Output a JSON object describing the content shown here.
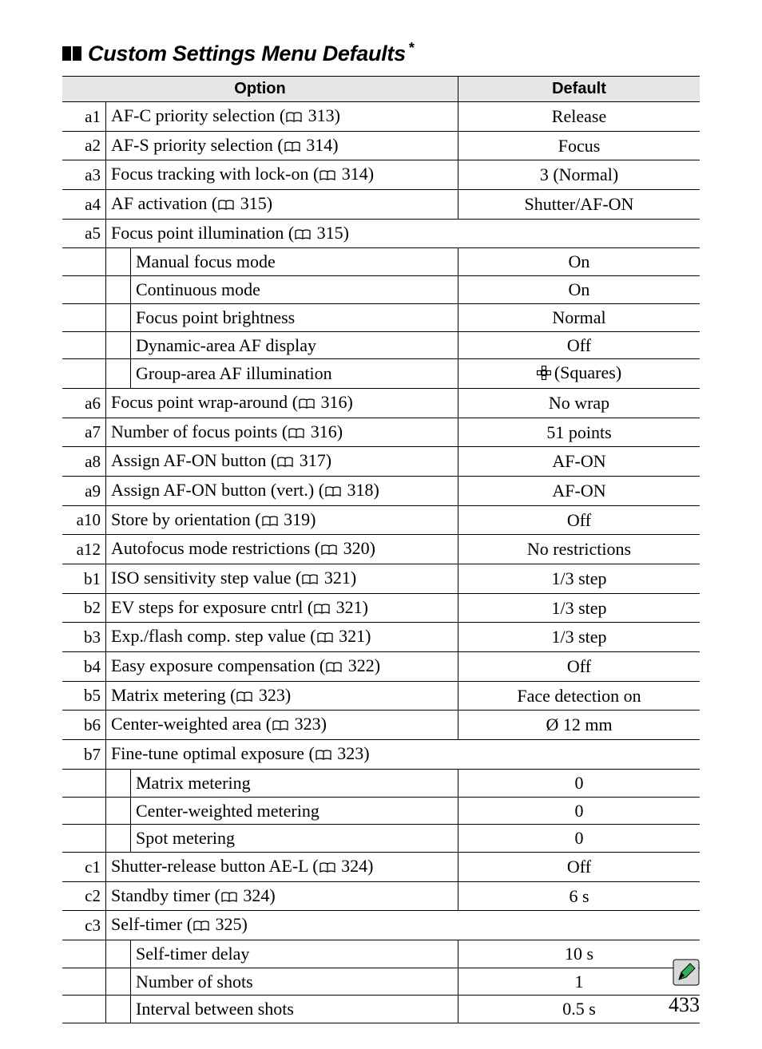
{
  "title": "Custom Settings Menu Defaults",
  "title_suffix": "*",
  "headers": {
    "option": "Option",
    "default": "Default"
  },
  "rows": [
    {
      "code": "a1",
      "label": "AF-C priority selection",
      "page": "313",
      "default": "Release"
    },
    {
      "code": "a2",
      "label": "AF-S priority selection",
      "page": "314",
      "default": "Focus"
    },
    {
      "code": "a3",
      "label": "Focus tracking with lock-on",
      "page": "314",
      "default": "3 (Normal)"
    },
    {
      "code": "a4",
      "label": "AF activation",
      "page": "315",
      "default": "Shutter/AF-ON"
    },
    {
      "code": "a5",
      "label": "Focus point illumination",
      "page": "315",
      "sub": [
        {
          "label": "Manual focus mode",
          "default": "On"
        },
        {
          "label": "Continuous mode",
          "default": "On"
        },
        {
          "label": "Focus point brightness",
          "default": "Normal"
        },
        {
          "label": "Dynamic-area AF display",
          "default": "Off"
        },
        {
          "label": "Group-area AF illumination",
          "default": "(Squares)",
          "icon": "squares"
        }
      ]
    },
    {
      "code": "a6",
      "label": "Focus point wrap-around",
      "page": "316",
      "default": "No wrap"
    },
    {
      "code": "a7",
      "label": "Number of focus points",
      "page": "316",
      "default": "51 points"
    },
    {
      "code": "a8",
      "label": "Assign AF-ON button",
      "page": "317",
      "default": "AF-ON"
    },
    {
      "code": "a9",
      "label": "Assign AF-ON button (vert.)",
      "page": "318",
      "default": "AF-ON"
    },
    {
      "code": "a10",
      "label": "Store by orientation",
      "page": "319",
      "default": "Off"
    },
    {
      "code": "a12",
      "label": "Autofocus mode restrictions",
      "page": "320",
      "default": "No restrictions"
    },
    {
      "code": "b1",
      "label": "ISO sensitivity step value",
      "page": "321",
      "default": "1/3 step"
    },
    {
      "code": "b2",
      "label": "EV steps for exposure cntrl",
      "page": "321",
      "default": "1/3 step"
    },
    {
      "code": "b3",
      "label": "Exp./flash comp. step value",
      "page": "321",
      "default": "1/3 step"
    },
    {
      "code": "b4",
      "label": "Easy exposure compensation",
      "page": "322",
      "default": "Off"
    },
    {
      "code": "b5",
      "label": "Matrix metering",
      "page": "323",
      "default": "Face detection on"
    },
    {
      "code": "b6",
      "label": "Center-weighted area",
      "page": "323",
      "default": "Ø 12 mm"
    },
    {
      "code": "b7",
      "label": "Fine-tune optimal exposure",
      "page": "323",
      "sub": [
        {
          "label": "Matrix metering",
          "default": "0"
        },
        {
          "label": "Center-weighted metering",
          "default": "0"
        },
        {
          "label": "Spot metering",
          "default": "0"
        }
      ]
    },
    {
      "code": "c1",
      "label": "Shutter-release button AE-L",
      "page": "324",
      "default": "Off"
    },
    {
      "code": "c2",
      "label": "Standby timer",
      "page": "324",
      "default": "6 s"
    },
    {
      "code": "c3",
      "label": "Self-timer",
      "page": "325",
      "sub": [
        {
          "label": "Self-timer delay",
          "default": "10 s"
        },
        {
          "label": "Number of shots",
          "default": "1"
        },
        {
          "label": "Interval between shots",
          "default": "0.5 s"
        }
      ]
    }
  ],
  "page_number": "433"
}
